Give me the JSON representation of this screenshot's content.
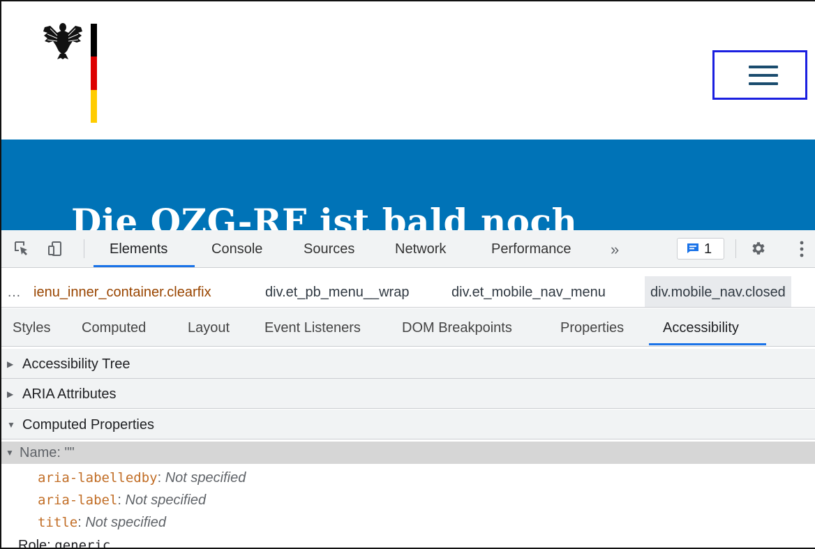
{
  "site": {
    "hero_heading": "Die OZG-RF ist bald noch"
  },
  "devtools": {
    "tabs": [
      {
        "label": "Elements",
        "active": true
      },
      {
        "label": "Console",
        "active": false
      },
      {
        "label": "Sources",
        "active": false
      },
      {
        "label": "Network",
        "active": false
      },
      {
        "label": "Performance",
        "active": false
      }
    ],
    "more_tabs": "»",
    "issues_count": "1",
    "breadcrumbs": {
      "ellipsis": "…",
      "items": [
        {
          "label": "ienu_inner_container.clearfix",
          "selected": false
        },
        {
          "label": "div.et_pb_menu__wrap",
          "selected": false
        },
        {
          "label": "div.et_mobile_nav_menu",
          "selected": false
        },
        {
          "label": "div.mobile_nav.closed",
          "selected": true
        }
      ]
    },
    "subtabs": [
      {
        "label": "Styles",
        "active": false
      },
      {
        "label": "Computed",
        "active": false
      },
      {
        "label": "Layout",
        "active": false
      },
      {
        "label": "Event Listeners",
        "active": false
      },
      {
        "label": "DOM Breakpoints",
        "active": false
      },
      {
        "label": "Properties",
        "active": false
      },
      {
        "label": "Accessibility",
        "active": true
      }
    ],
    "sections": [
      {
        "label": "Accessibility Tree",
        "expanded": false
      },
      {
        "label": "ARIA Attributes",
        "expanded": false
      },
      {
        "label": "Computed Properties",
        "expanded": true
      }
    ],
    "name_row": "Name: \"\"",
    "properties": [
      {
        "key": "aria-labelledby",
        "value": "Not specified"
      },
      {
        "key": "aria-label",
        "value": "Not specified"
      },
      {
        "key": "title",
        "value": "Not specified"
      }
    ],
    "role": {
      "label": "Role:",
      "value": "generic"
    }
  },
  "colors": {
    "hero_blue": "#0073b7",
    "highlight_border": "#1a1fe0",
    "tab_underline": "#1a73e8",
    "aria_key": "#c16d25",
    "selector_purple": "#881280"
  }
}
